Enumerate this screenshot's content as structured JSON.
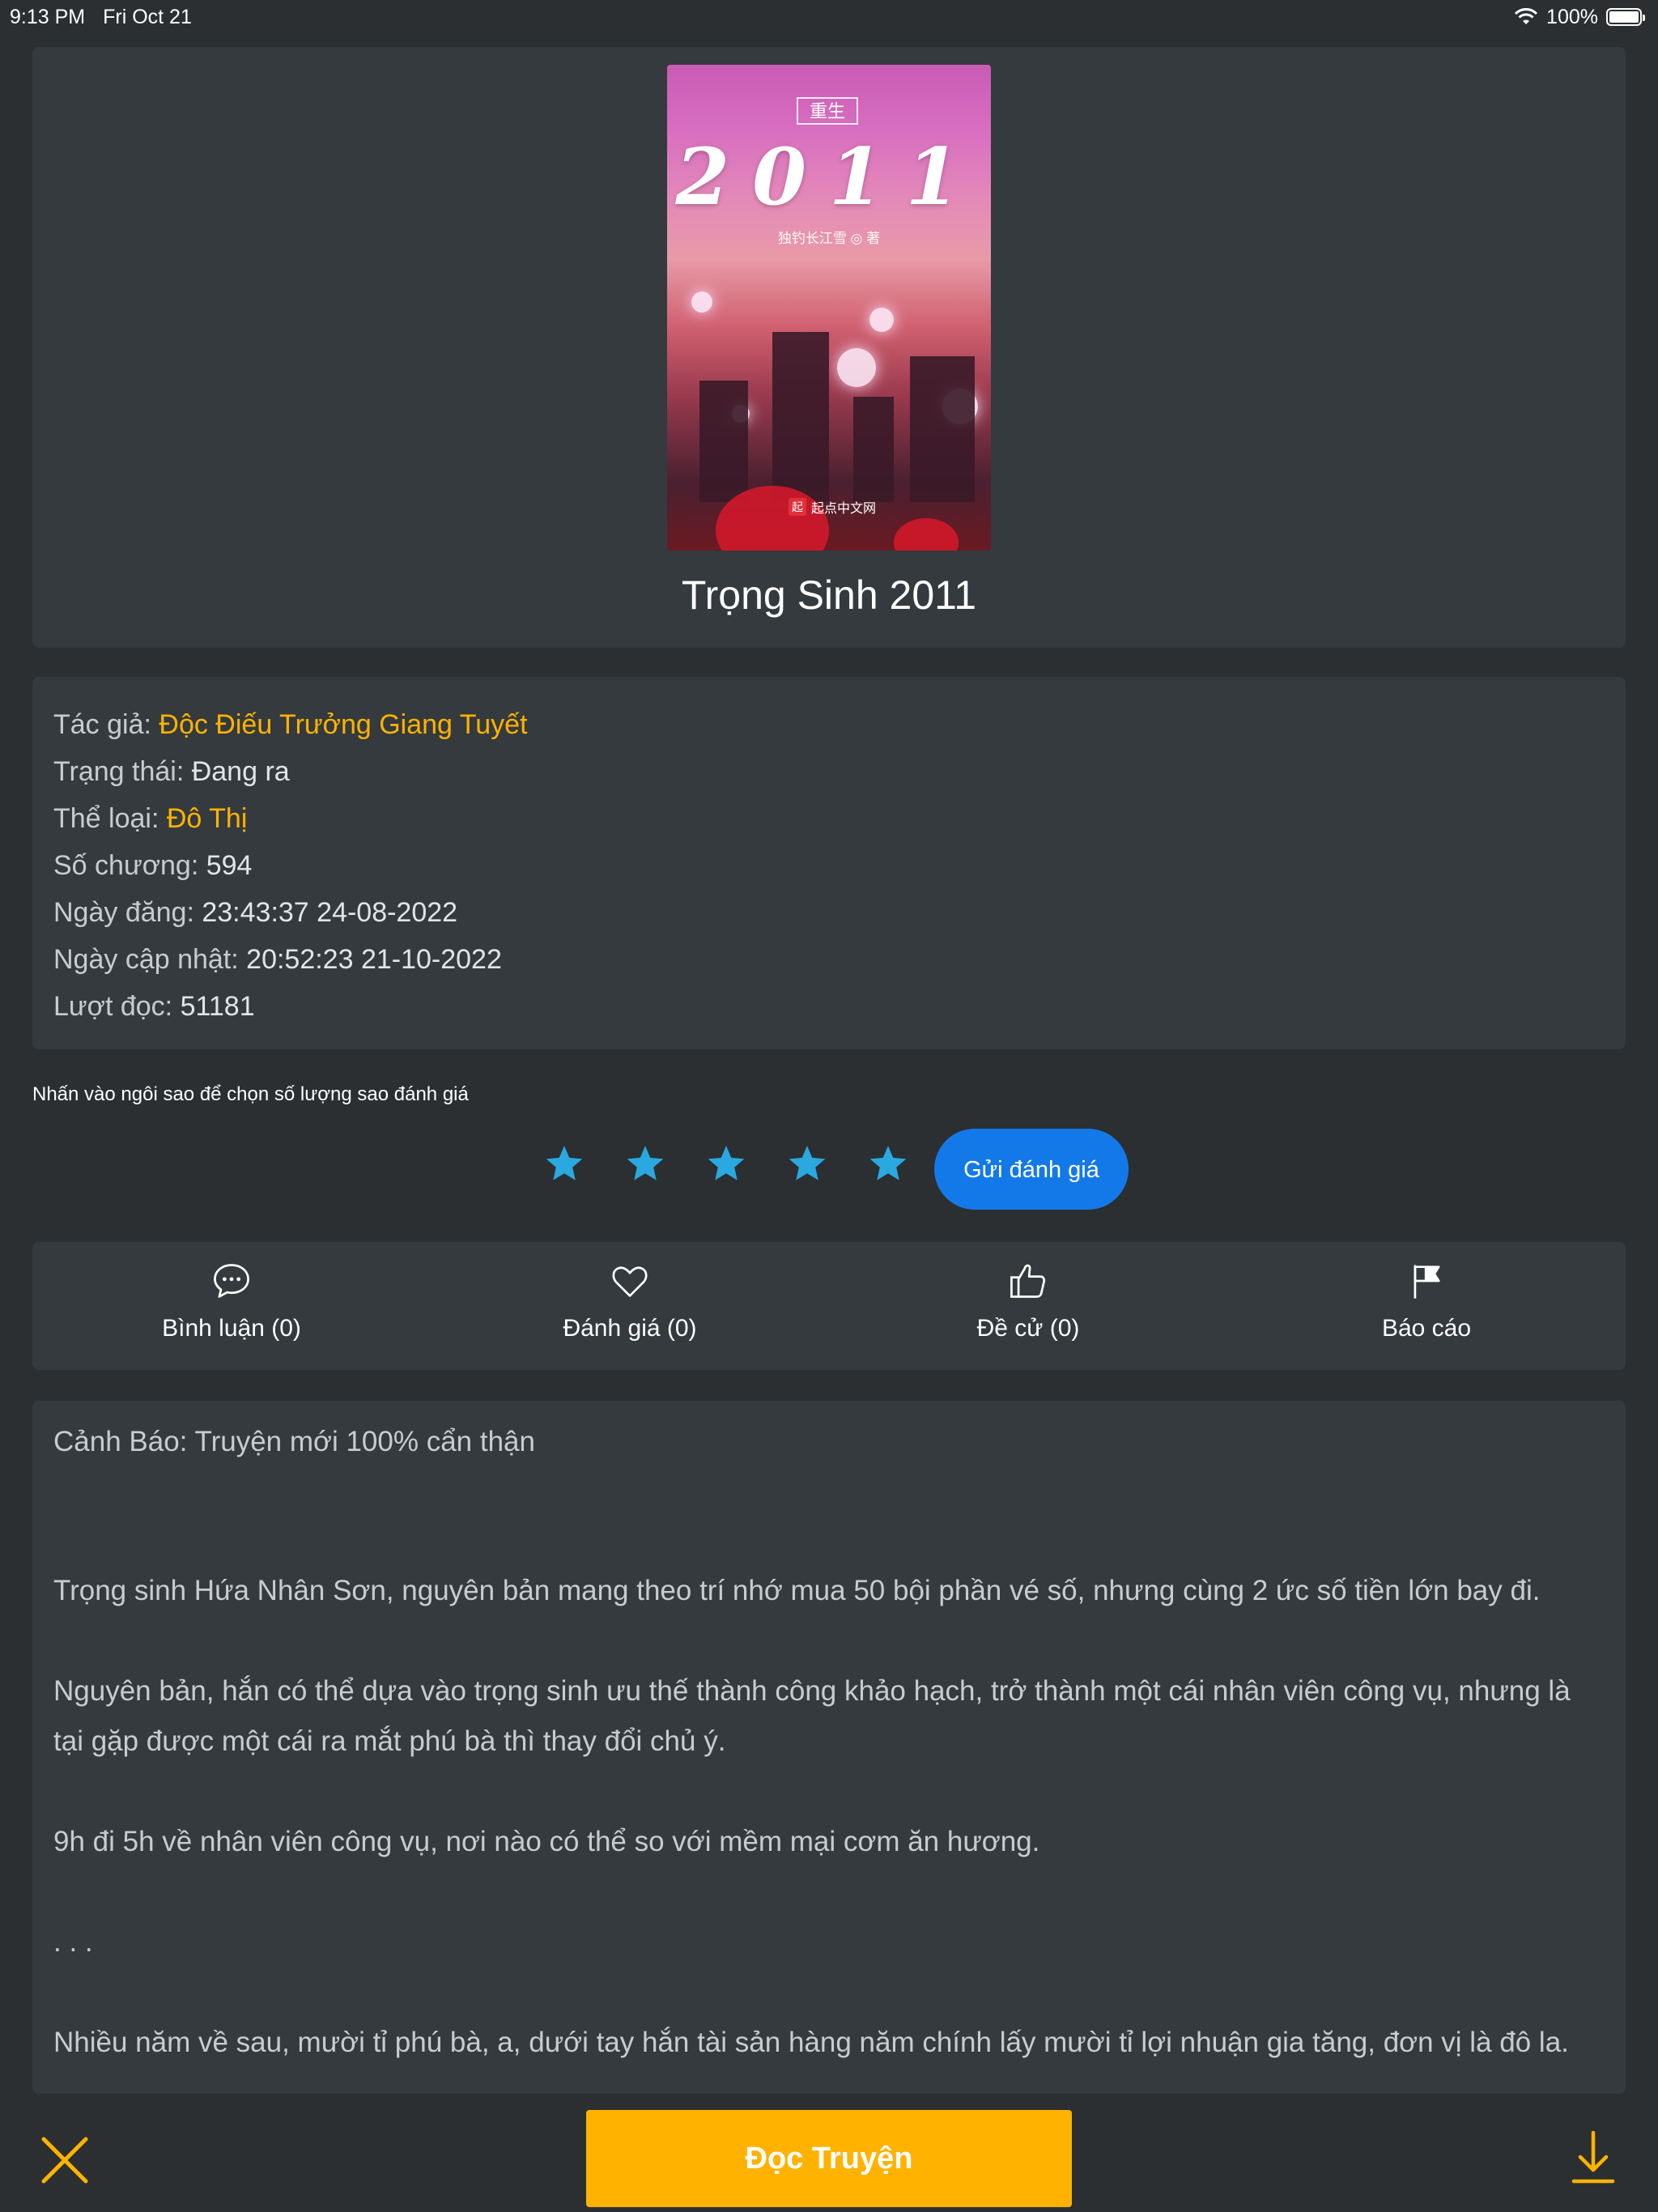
{
  "status_bar": {
    "time": "9:13 PM",
    "date": "Fri Oct 21",
    "battery": "100%"
  },
  "book": {
    "title": "Trọng Sinh 2011",
    "cover": {
      "top_text": "重生",
      "number_text": "2011",
      "author_text": "独钓长江雪 ◎ 著",
      "publisher_text": "起点中文网",
      "publisher_logo": "起"
    }
  },
  "info": {
    "author_label": "Tác giả: ",
    "author_value": "Độc Điếu Trưởng Giang Tuyết",
    "status_label": "Trạng thái: ",
    "status_value": "Đang ra",
    "genre_label": "Thể loại: ",
    "genre_value": "Đô Thị",
    "chapters_label": "Số chương: ",
    "chapters_value": "594",
    "posted_label": "Ngày đăng: ",
    "posted_value": "23:43:37 24-08-2022",
    "updated_label": "Ngày cập nhật: ",
    "updated_value": "20:52:23 21-10-2022",
    "views_label": "Lượt đọc: ",
    "views_value": "51181"
  },
  "rating": {
    "hint": "Nhấn vào ngôi sao để chọn số lượng sao đánh giá",
    "stars_selected": 5,
    "stars_total": 5,
    "submit_label": "Gửi đánh giá",
    "star_color": "#2aa8e0"
  },
  "actions": {
    "comments": "Bình luận (0)",
    "reviews": "Đánh giá (0)",
    "nominate": "Đề cử (0)",
    "report": "Báo cáo"
  },
  "description": {
    "p1": "Cảnh Báo: Truyện mới 100% cẩn thận",
    "p2": "Trọng sinh Hứa Nhân Sơn, nguyên bản mang theo trí nhớ mua 50 bội phần vé số, nhưng cùng 2 ức số tiền lớn bay đi.",
    "p3": "Nguyên bản, hắn có thể dựa vào trọng sinh ưu thế thành công khảo hạch, trở thành một cái nhân viên công vụ, nhưng là tại gặp được một cái ra mắt phú bà thì thay đổi chủ ý.",
    "p4": "9h đi 5h về nhân viên công vụ, nơi nào có thể so với mềm mại cơm ăn hương.",
    "p5": ". . .",
    "p6": "Nhiều năm về sau, mười tỉ phú bà, a, dưới tay hắn tài sản hàng năm chính lấy mười tỉ lợi nhuận gia tăng, đơn vị là đô la."
  },
  "bottom": {
    "read_label": "Đọc Truyện",
    "accent": "#ffb300"
  }
}
